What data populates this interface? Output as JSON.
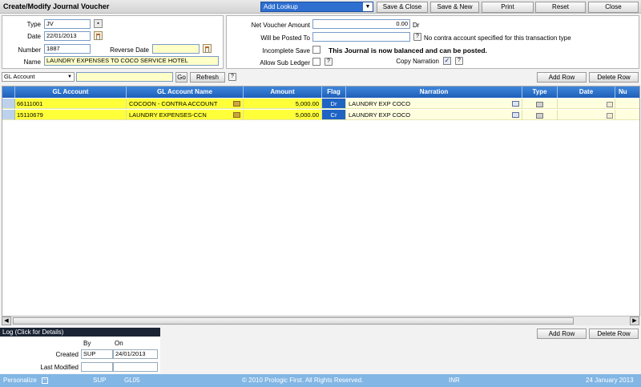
{
  "header": {
    "title": "Create/Modify Journal Voucher",
    "lookup_value": "Add Lookup",
    "buttons": {
      "save_close": "Save & Close",
      "save_new": "Save & New",
      "print": "Print",
      "reset": "Reset",
      "close": "Close"
    }
  },
  "voucher": {
    "type_label": "Type",
    "type_value": "JV",
    "date_label": "Date",
    "date_value": "22/01/2013",
    "number_label": "Number",
    "number_value": "1887",
    "reverse_date_label": "Reverse Date",
    "reverse_date_value": "",
    "name_label": "Name",
    "name_value": "LAUNDRY EXPENSES TO COCO SERVICE HOTEL"
  },
  "summary": {
    "net_amount_label": "Net Voucher Amount",
    "net_amount_value": "0.00",
    "net_amount_suffix": "Dr",
    "posted_to_label": "Will be Posted To",
    "posted_to_value": "",
    "posted_to_note": "No contra account specified for this transaction type",
    "incomplete_save_label": "Incomplete Save",
    "balanced_msg": "This Journal is now balanced and can be posted.",
    "allow_sub_ledger_label": "Allow Sub Ledger",
    "copy_narration_label": "Copy Narration",
    "question": "?"
  },
  "grid_toolbar": {
    "search_field": "GL Account",
    "search_value": "",
    "go": "Go",
    "refresh": "Refresh",
    "help": "?",
    "add_row": "Add Row",
    "delete_row": "Delete Row"
  },
  "table": {
    "columns": [
      "GL Account",
      "GL Account Name",
      "Amount",
      "Flag",
      "Narration",
      "Type",
      "Date",
      "Nu"
    ],
    "rows": [
      {
        "account": "66111001",
        "name": "COCOON - CONTRA ACCOUNT",
        "amount": "5,000.00",
        "flag": "Dr",
        "narration": "LAUNDRY EXP COCO"
      },
      {
        "account": "15110679",
        "name": "LAUNDRY EXPENSES-CCN",
        "amount": "5,000.00",
        "flag": "Cr",
        "narration": "LAUNDRY EXP COCO"
      }
    ]
  },
  "bottom_toolbar": {
    "add_row": "Add Row",
    "delete_row": "Delete Row"
  },
  "log": {
    "title": "Log  (Click for Details)",
    "col_by": "By",
    "col_on": "On",
    "created_label": "Created",
    "created_by": "SUP",
    "created_on": "24/01/2013",
    "modified_label": "Last Modified",
    "modified_by": "",
    "modified_on": ""
  },
  "footer": {
    "personalize": "Personalize",
    "user": "SUP",
    "company": "GL05",
    "copyright": "© 2010 Prologic First. All Rights Reserved.",
    "currency": "INR",
    "date": "24 January 2013"
  }
}
